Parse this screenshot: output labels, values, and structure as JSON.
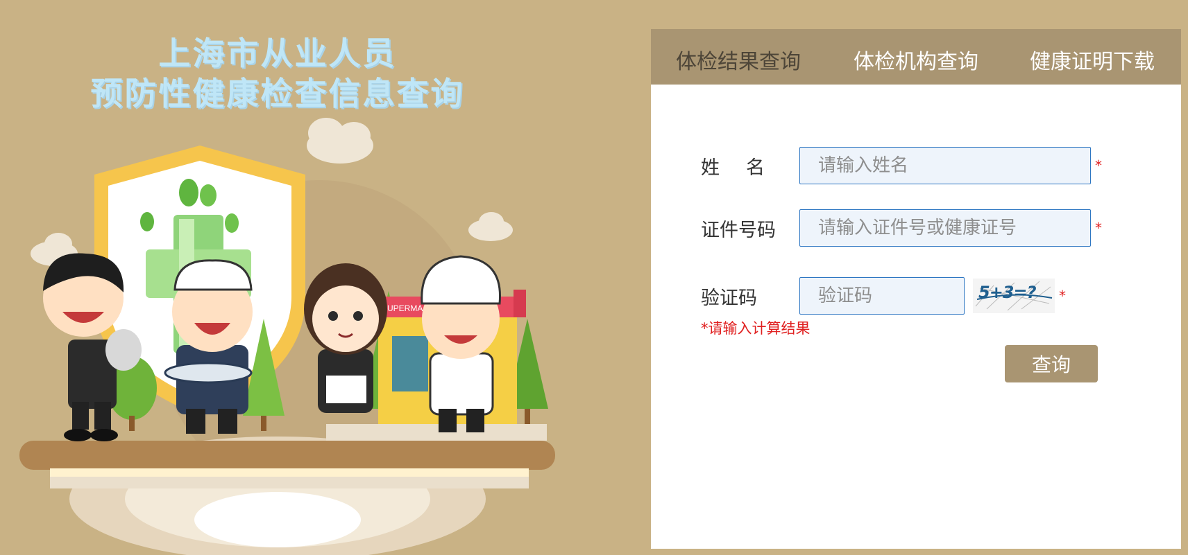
{
  "hero": {
    "title_line1": "上海市从业人员",
    "title_line2": "预防性健康检查信息查询",
    "shop_sign": "SUPERMA"
  },
  "tabs": [
    {
      "label": "体检结果查询",
      "active": true
    },
    {
      "label": "体检机构查询",
      "active": false
    },
    {
      "label": "健康证明下载",
      "active": false
    }
  ],
  "form": {
    "name": {
      "label": "姓名",
      "placeholder": "请输入姓名",
      "required_mark": "*"
    },
    "id": {
      "label": "证件号码",
      "placeholder": "请输入证件号或健康证号",
      "required_mark": "*"
    },
    "captcha": {
      "label": "验证码",
      "placeholder": "验证码",
      "image_text": "5+3=?",
      "required_mark": "*"
    },
    "hint": "*请输入计算结果",
    "submit_label": "查询"
  },
  "colors": {
    "background": "#c9b285",
    "accent": "#a99572",
    "input_border": "#2d76c2",
    "error": "#e02020"
  }
}
